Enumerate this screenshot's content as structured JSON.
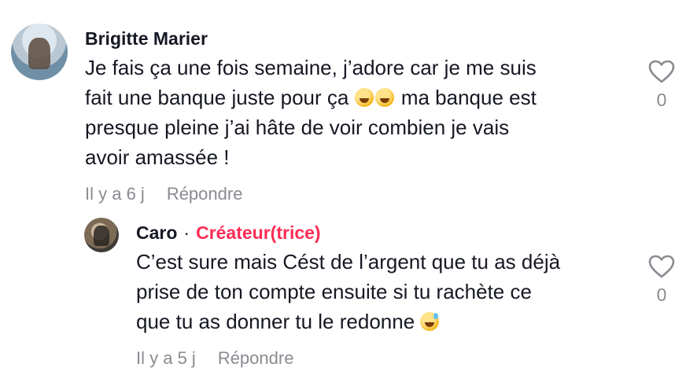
{
  "comment": {
    "author": "Brigitte Marier",
    "lines": [
      "Je fais ça une fois semaine, j’adore car je me suis",
      "fait une banque juste pour ça",
      "ma banque est",
      "presque pleine j’ai hâte de voir combien je vais",
      "avoir amassée !"
    ],
    "time": "Il y a 6 j",
    "reply_label": "Répondre",
    "like_count": "0"
  },
  "reply": {
    "author": "Caro",
    "separator": "·",
    "badge": "Créateur(trice)",
    "lines": [
      "C’est sure mais Cést de l’argent que tu as déjà",
      "prise de ton compte ensuite si tu rachète ce",
      "que tu as donner tu le redonne"
    ],
    "time": "Il y a 5 j",
    "reply_label": "Répondre",
    "like_count": "0"
  },
  "icons": {
    "like": "heart-outline-icon",
    "emoji_laugh": "rofl-emoji-icon",
    "emoji_sweat": "grinning-sweat-emoji-icon"
  },
  "colors": {
    "text": "#161823",
    "muted": "#8a8b91",
    "creator_accent": "#fe2c55"
  }
}
